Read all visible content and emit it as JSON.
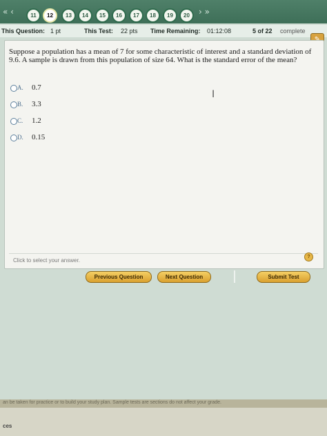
{
  "nav": {
    "prev_arrows": "«  ‹",
    "next_arrows": "›  »",
    "questions": [
      "11",
      "12",
      "13",
      "14",
      "15",
      "16",
      "17",
      "18",
      "19",
      "20"
    ],
    "current_question": "12"
  },
  "status": {
    "this_question_label": "This Question:",
    "this_question_value": "1 pt",
    "this_test_label": "This Test:",
    "this_test_value": "22 pts",
    "time_label": "Time Remaining:",
    "time_value": "01:12:08",
    "progress": "5 of 22",
    "complete": "complete"
  },
  "question": {
    "text": "Suppose a population has a mean of 7 for some characteristic of interest and a standard deviation of 9.6. A sample is drawn from this population of size 64. What is the standard error of the mean?"
  },
  "answers": [
    {
      "letter": "A.",
      "value": "0.7"
    },
    {
      "letter": "B.",
      "value": "3.3"
    },
    {
      "letter": "C.",
      "value": "1.2"
    },
    {
      "letter": "D.",
      "value": "0.15"
    }
  ],
  "hint": "Click to select your answer.",
  "buttons": {
    "previous": "Previous Question",
    "next": "Next Question",
    "submit": "Submit Test"
  },
  "footer": {
    "note": "an be taken for practice or to build your study plan. Sample tests are sections do not affect your grade.",
    "label": "ces"
  }
}
